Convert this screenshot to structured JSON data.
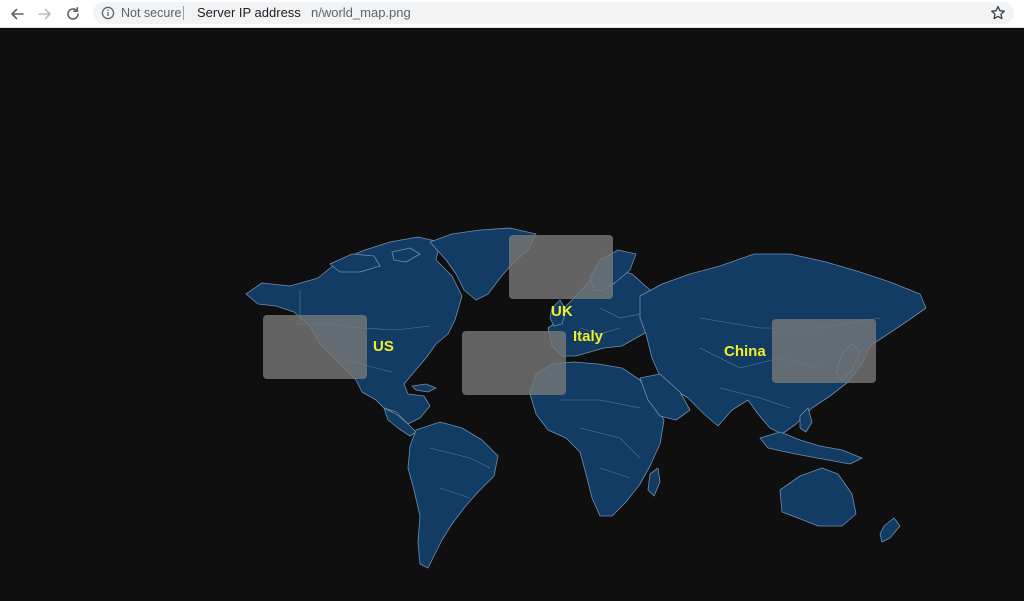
{
  "browser": {
    "security_label": "Not secure",
    "host": "Server IP address",
    "path": "n/world_map.png",
    "icons": {
      "back": "arrow-left-icon",
      "forward": "arrow-right-icon",
      "reload": "reload-icon",
      "info": "info-circle-icon",
      "bookmark": "star-icon"
    }
  },
  "map": {
    "background_color": "#0f0f0f",
    "land_color": "#123c63",
    "label_color": "#f0ee2b",
    "labels": {
      "us": "US",
      "uk": "UK",
      "italy": "Italy",
      "china": "China"
    }
  }
}
